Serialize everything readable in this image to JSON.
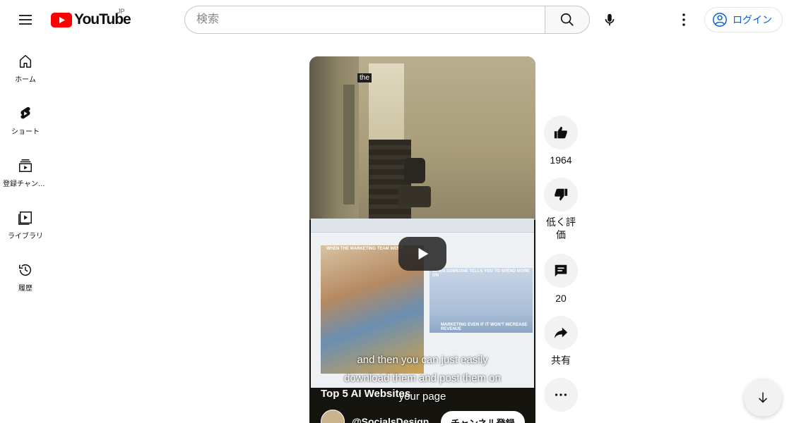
{
  "header": {
    "logo_text": "YouTube",
    "country_code": "JP",
    "search_placeholder": "検索",
    "login_label": "ログイン"
  },
  "sidebar": {
    "items": [
      {
        "label": "ホーム",
        "icon": "home-icon"
      },
      {
        "label": "ショート",
        "icon": "shorts-icon"
      },
      {
        "label": "登録チャンネル",
        "icon": "subscriptions-icon"
      },
      {
        "label": "ライブラリ",
        "icon": "library-icon"
      },
      {
        "label": "履歴",
        "icon": "history-icon"
      }
    ]
  },
  "video": {
    "caption_top": "the",
    "meme_tag_1": "WHEN THE MARKETING TEAM WENT",
    "meme_tag_2": "WHEN SOMEONE TELLS YOU TO SPEND MORE ON",
    "meme_tag_3": "MARKETING EVEN IF IT WON'T INCREASE REVENUE",
    "subtitle_line_1": "and then you can just easily",
    "subtitle_line_2": "download them and post them on",
    "subtitle_line_3": "your page",
    "title": "Top 5 AI Websites",
    "channel_name": "@SocialsDesign",
    "subscribe_label": "チャンネル登録"
  },
  "actions": {
    "like_count": "1964",
    "dislike_label": "低く評価",
    "comment_count": "20",
    "share_label": "共有"
  },
  "colors": {
    "brand_red": "#ff0000",
    "link_blue": "#065fd4",
    "button_gray": "#f2f2f2"
  }
}
